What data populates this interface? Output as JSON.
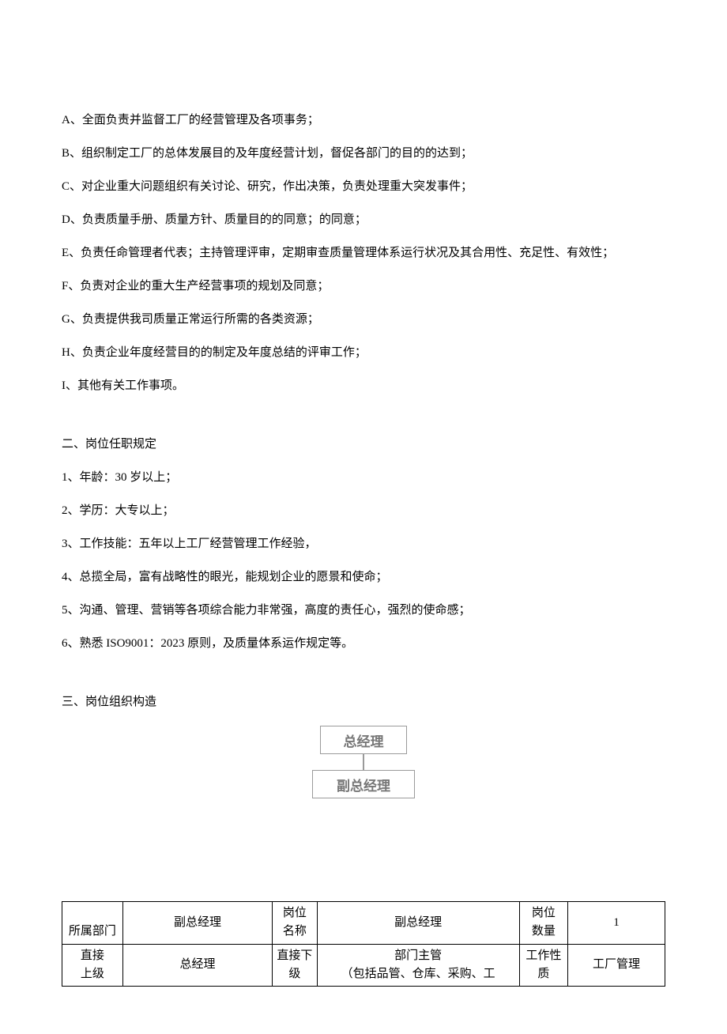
{
  "duties": {
    "A": "A、全面负责并监督工厂的经营管理及各项事务；",
    "B": "B、组织制定工厂的总体发展目的及年度经营计划，督促各部门的目的的达到；",
    "C": "C、对企业重大问题组织有关讨论、研究，作出决策，负责处理重大突发事件；",
    "D": "D、负责质量手册、质量方针、质量目的的同意；的同意；",
    "E": "E、负责任命管理者代表；主持管理评审，定期审查质量管理体系运行状况及其合用性、充足性、有效性；",
    "F": "F、负责对企业的重大生产经营事项的规划及同意；",
    "G": "G、负责提供我司质量正常运行所需的各类资源；",
    "H": "H、负责企业年度经营目的的制定及年度总结的评审工作；",
    "I": "I、其他有关工作事项。"
  },
  "sections": {
    "s2_title": "二、岗位任职规定",
    "s2_items": {
      "i1": "1、年龄：30 岁以上；",
      "i2": "2、学历：大专以上；",
      "i3": "3、工作技能：五年以上工厂经营管理工作经验，",
      "i4": "4、总揽全局，富有战略性的眼光，能规划企业的愿景和使命；",
      "i5": "5、沟通、管理、营销等各项综合能力非常强，高度的责任心，强烈的使命感；",
      "i6": "6、熟悉 ISO9001：2023 原则，及质量体系运作规定等。"
    },
    "s3_title": "三、岗位组织构造"
  },
  "org": {
    "top": "总经理",
    "bottom": "副总经理"
  },
  "table": {
    "r1": {
      "l1": "所属部门",
      "v1": "副总经理",
      "l2a": "岗位",
      "l2b": "名称",
      "v2": "副总经理",
      "l3a": "岗位",
      "l3b": "数量",
      "v3": "1"
    },
    "r2": {
      "l1a": "直接",
      "l1b": "上级",
      "v1": "总经理",
      "l2a": "直接下",
      "l2b": "级",
      "v2a": "部门主管",
      "v2b": "（包括品管、仓库、采购、工",
      "l3a": "工作性",
      "l3b": "质",
      "v3": "工厂管理"
    }
  }
}
